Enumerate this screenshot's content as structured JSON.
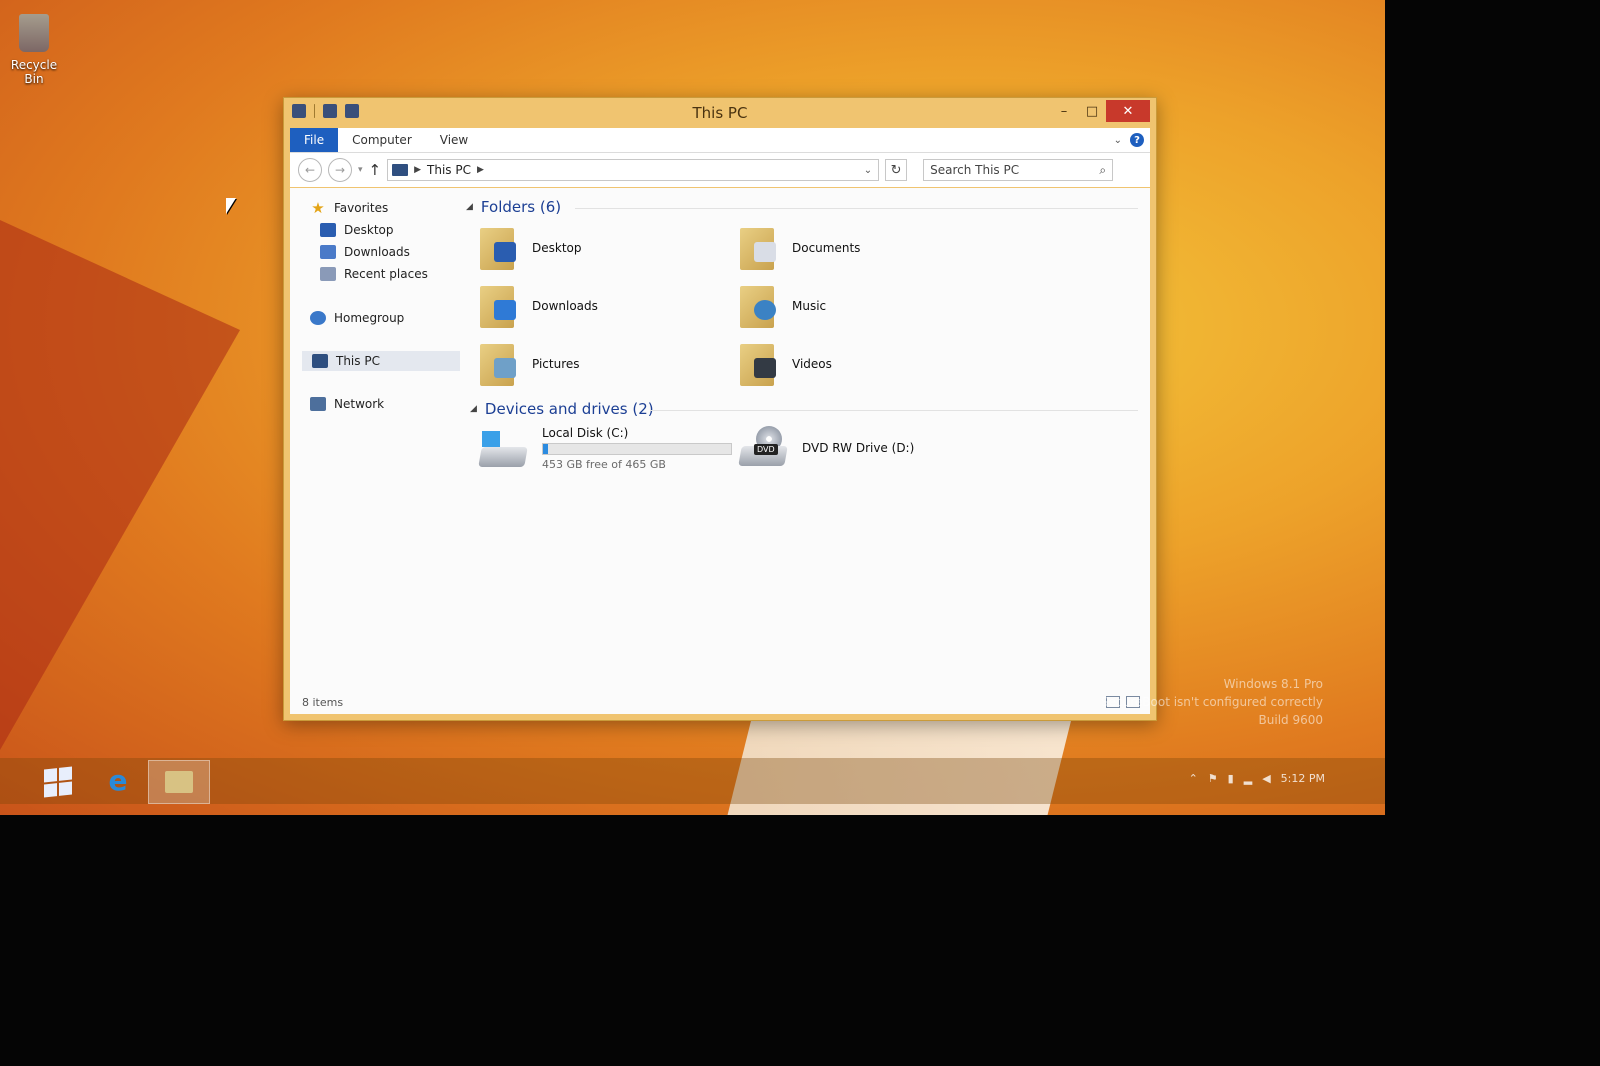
{
  "desktop": {
    "recycle_bin_label": "Recycle Bin",
    "watermark_line1": "Windows 8.1 Pro",
    "watermark_line2": "SecureBoot isn't configured correctly",
    "watermark_line3": "Build 9600",
    "clock": "5:12 PM"
  },
  "window": {
    "title": "This PC",
    "ribbon_tabs": [
      "File",
      "Computer",
      "View"
    ],
    "address": {
      "crumb": "This PC"
    },
    "search": {
      "placeholder": "Search This PC"
    }
  },
  "navpane": {
    "favorites": "Favorites",
    "favorites_items": [
      "Desktop",
      "Downloads",
      "Recent places"
    ],
    "homegroup": "Homegroup",
    "this_pc": "This PC",
    "network": "Network"
  },
  "folders": {
    "header": "Folders (6)",
    "items": [
      "Desktop",
      "Documents",
      "Downloads",
      "Music",
      "Pictures",
      "Videos"
    ]
  },
  "devices": {
    "header": "Devices and drives (2)",
    "local_disk": {
      "name": "Local Disk (C:)",
      "free_text": "453 GB free of 465 GB",
      "used_fraction": 0.026
    },
    "dvd": {
      "name": "DVD RW Drive (D:)",
      "badge": "DVD"
    }
  },
  "status": {
    "items_count": "8 items"
  },
  "colors": {
    "accent": "#1e5fbf",
    "group_header": "#1c3f94",
    "close_button": "#c8392b",
    "disk_bar": "#2b8be0"
  }
}
